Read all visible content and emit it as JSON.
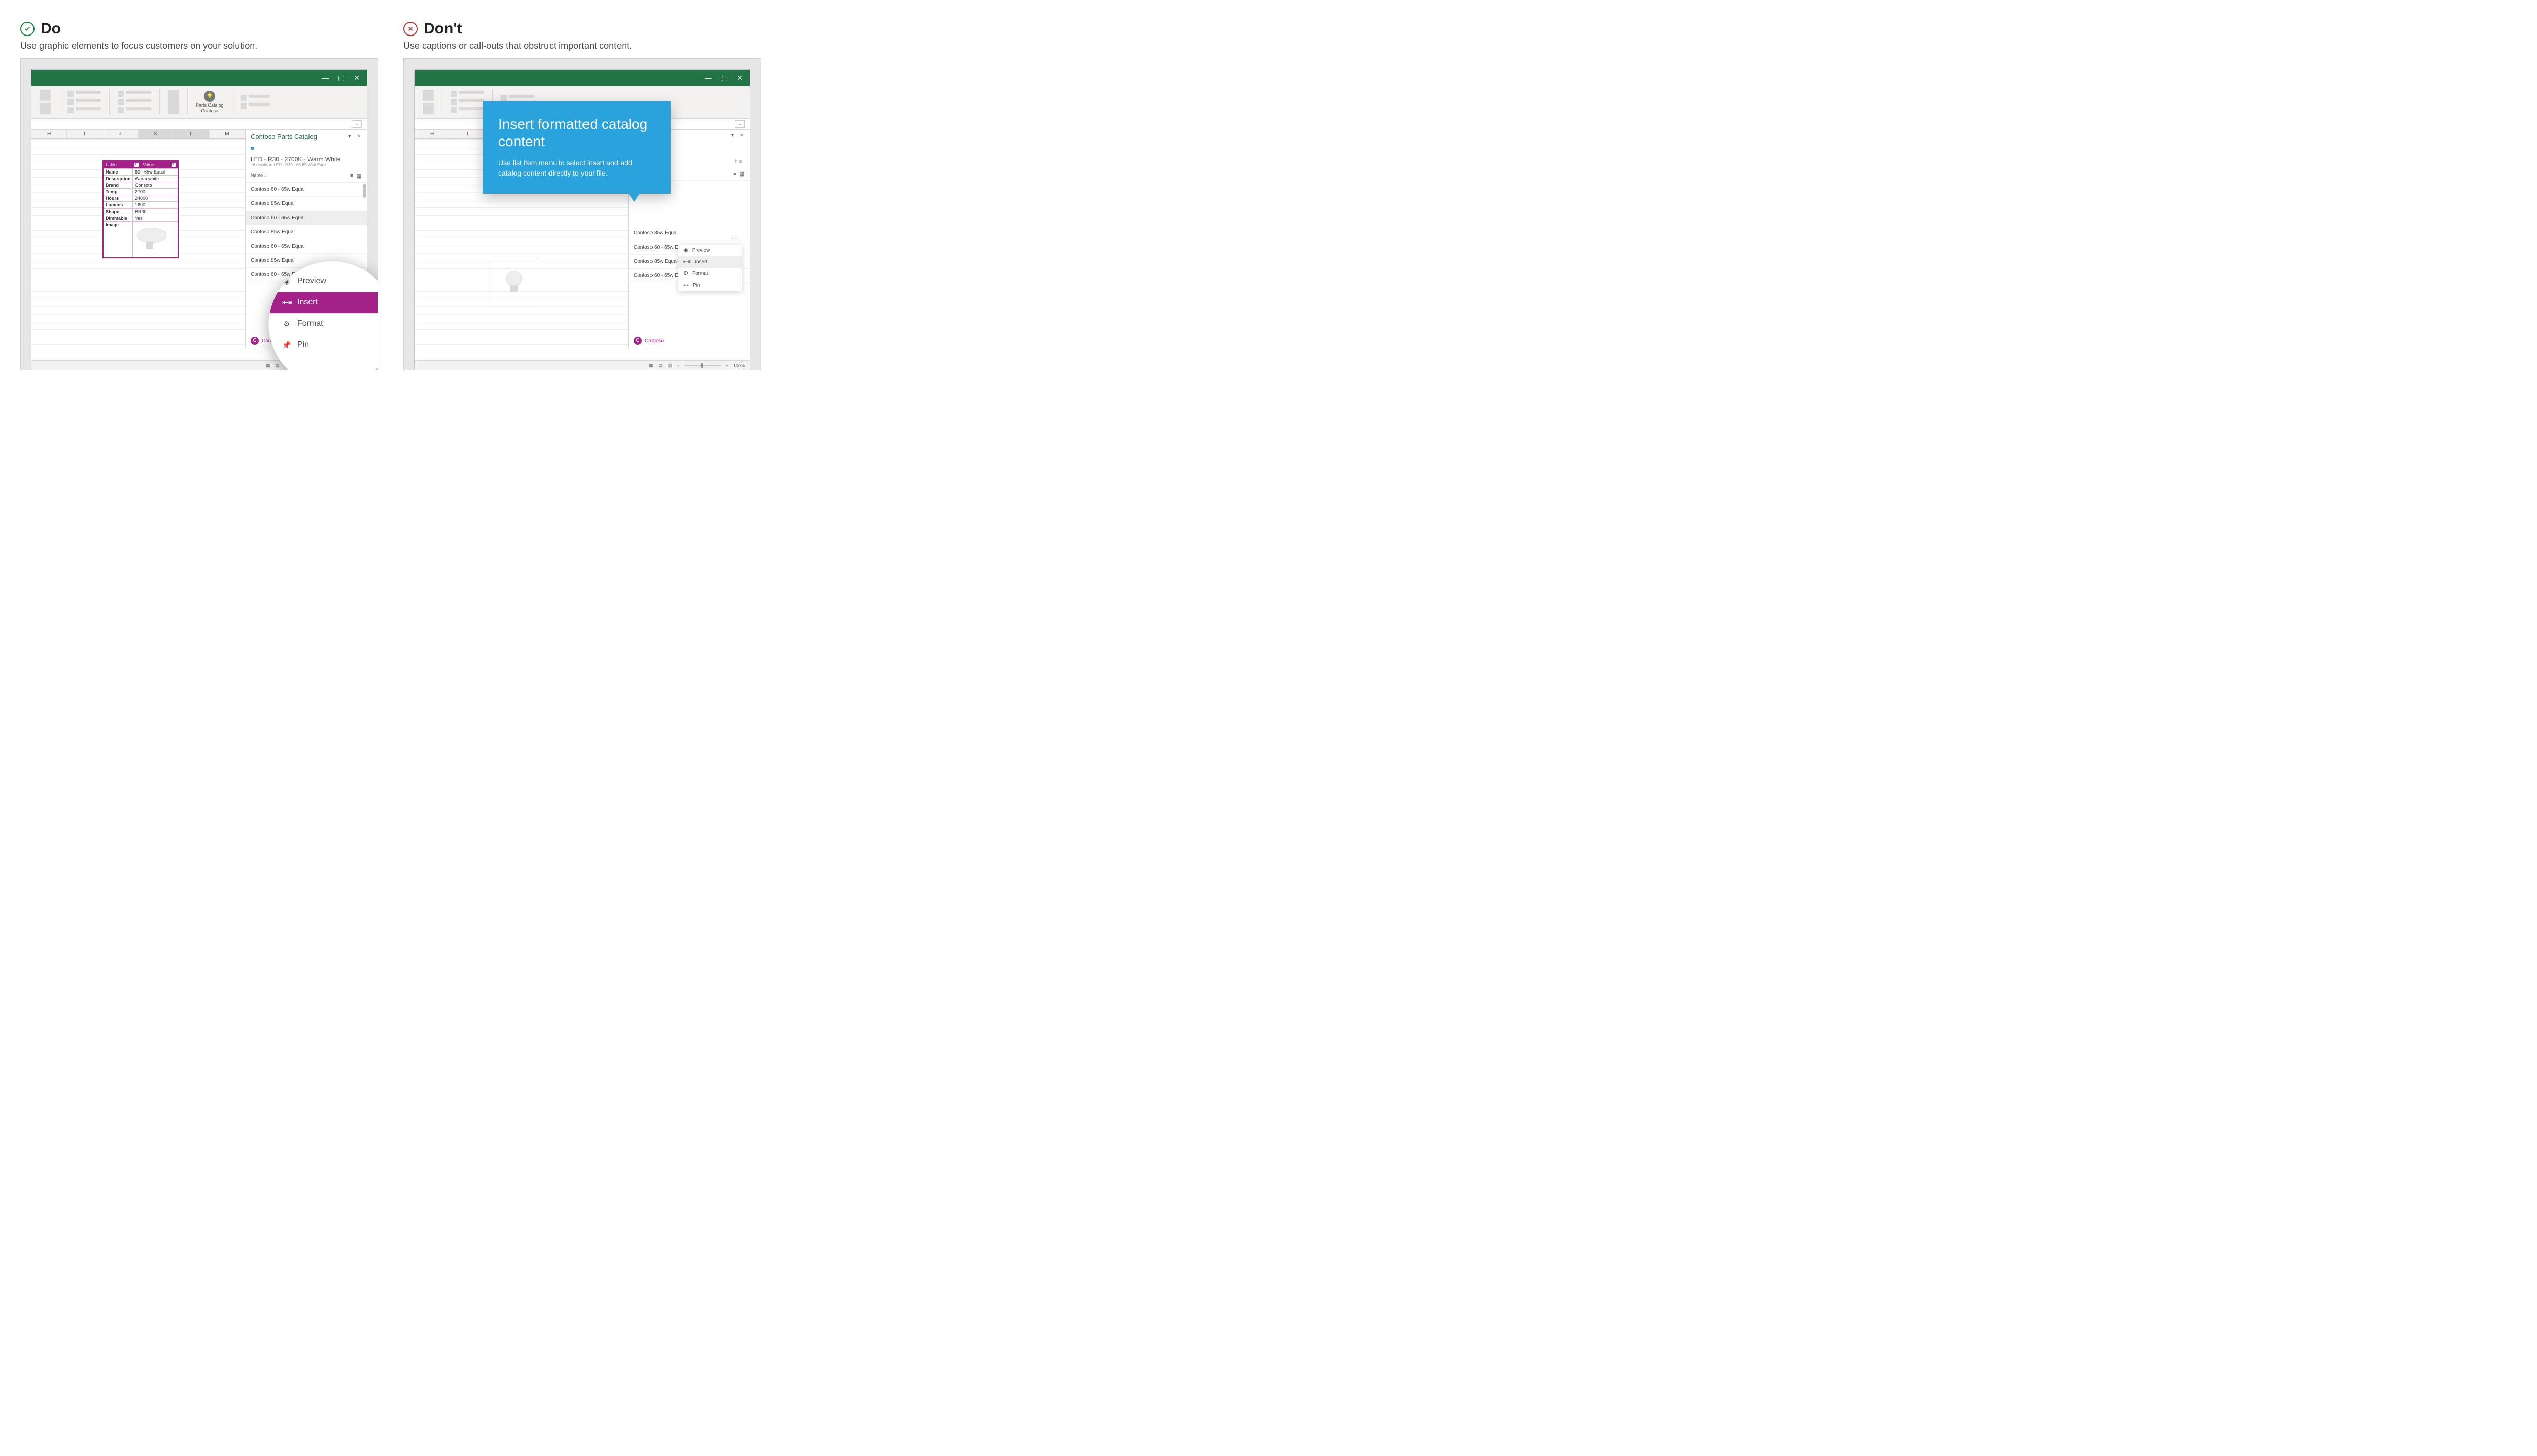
{
  "do": {
    "heading": "Do",
    "subtitle": "Use graphic elements to focus customers on your solution."
  },
  "dont": {
    "heading": "Don't",
    "subtitle": "Use captions or call-outs that obstruct important content."
  },
  "ribbon_addin": {
    "line1": "Parts Catalog",
    "line2": "Contoso"
  },
  "columns": [
    "H",
    "I",
    "J",
    "K",
    "L",
    "M"
  ],
  "table": {
    "headers": [
      "Lable",
      "Value"
    ],
    "rows": [
      [
        "Name",
        "60 - 65w Equal"
      ],
      [
        "Description",
        "Warm white"
      ],
      [
        "Brand",
        "Consoto"
      ],
      [
        "Temp",
        "2700"
      ],
      [
        "Hours",
        "24000"
      ],
      [
        "Lumens",
        "1600"
      ],
      [
        "Shape",
        "BR30"
      ],
      [
        "Dimmable",
        "Yes"
      ],
      [
        "Image",
        ""
      ]
    ]
  },
  "taskpane": {
    "title": "Contoso Parts Catalog",
    "product": "LED - R30 - 2700K - Warm White",
    "sub": "16 results in LED - R30 - 60-65 Watt Equal",
    "sort_label": "Name",
    "items": [
      "Contoso 60 - 65w Equal",
      "Contoso 85w Equal",
      "Contoso 60 - 65w Equal",
      "Contoso 85w Equal",
      "Contoso 60 - 65w Equal",
      "Contoso 85w Equal",
      "Contoso 60 - 65w Equal"
    ],
    "brand": "Contoso"
  },
  "lens_menu": [
    "Preview",
    "Insert",
    "Format",
    "Pin"
  ],
  "ctx_menu": [
    "Preview",
    "Insert",
    "Format",
    "Pin"
  ],
  "callout": {
    "title": "Insert formatted catalog content",
    "body": "Use list item menu to select insert and add catalog content directly to your file."
  },
  "status": {
    "zoom": "100%"
  }
}
